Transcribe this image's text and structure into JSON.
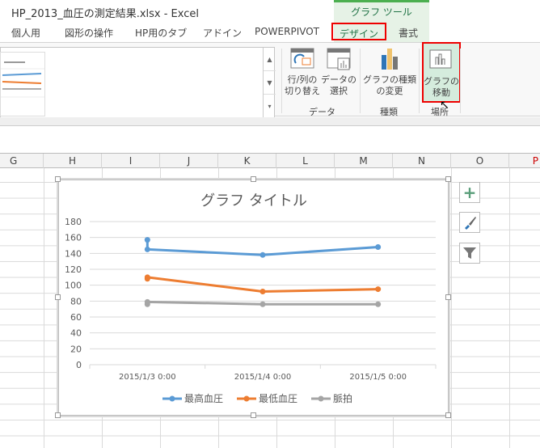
{
  "window": {
    "title": "HP_2013_血圧の測定結果.xlsx - Excel"
  },
  "context_tab": "グラフ ツール",
  "tabs": [
    "個人用",
    "図形の操作",
    "HP用のタブ",
    "アドイン",
    "POWERPIVOT",
    "デザイン",
    "書式"
  ],
  "ribbon": {
    "switch_label": [
      "行/列の",
      "切り替え"
    ],
    "select_data": [
      "データの",
      "選択"
    ],
    "data_group": "データ",
    "change_type": [
      "グラフの種類",
      "の変更"
    ],
    "type_group": "種類",
    "move_chart": [
      "グラフの",
      "移動"
    ],
    "location_group": "場所"
  },
  "columns": [
    "G",
    "H",
    "I",
    "J",
    "K",
    "L",
    "M",
    "N",
    "O",
    "P"
  ],
  "chart_data": {
    "type": "line",
    "title": "グラフ タイトル",
    "categories": [
      "2015/1/3 0:00",
      "2015/1/4 0:00",
      "2015/1/5 0:00"
    ],
    "x": [
      0,
      0,
      1,
      2
    ],
    "ylim": [
      0,
      180
    ],
    "yticks": [
      0,
      20,
      40,
      60,
      80,
      100,
      120,
      140,
      160,
      180
    ],
    "series": [
      {
        "name": "最高血圧",
        "color": "#5b9bd5",
        "values": [
          157,
          145,
          138,
          148
        ]
      },
      {
        "name": "最低血圧",
        "color": "#ed7d31",
        "values": [
          108,
          110,
          92,
          95
        ]
      },
      {
        "name": "脈拍",
        "color": "#a5a5a5",
        "values": [
          76,
          79,
          76,
          76
        ]
      }
    ],
    "legend": "bottom",
    "grid": true
  }
}
